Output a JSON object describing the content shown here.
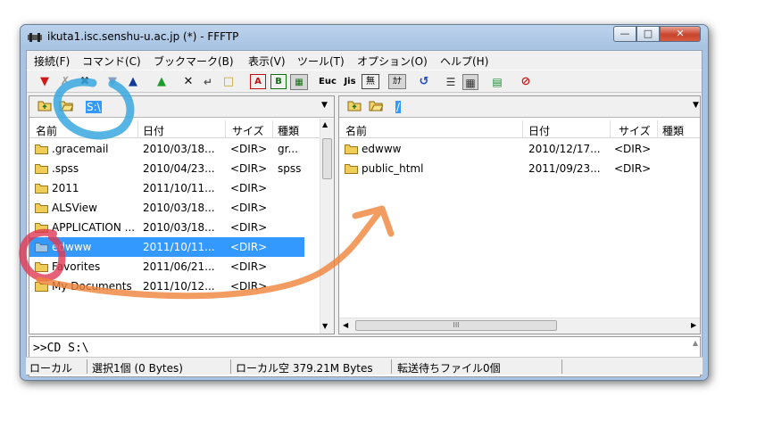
{
  "window": {
    "title": "ikuta1.isc.senshu-u.ac.jp (*) - FFFTP",
    "min_glyph": "—",
    "max_glyph": "□",
    "close_glyph": "✕"
  },
  "menu": [
    "接続(F)",
    "コマンド(C)",
    "ブックマーク(B)",
    "表示(V)",
    "ツール(T)",
    "オプション(O)",
    "ヘルプ(H)"
  ],
  "toolbar": {
    "ascii": "A",
    "binary": "B",
    "euc": "Euc",
    "jis": "Jis",
    "no_conv": "無",
    "kana": "ｶﾅ"
  },
  "local": {
    "path": "S:\\",
    "headers": {
      "name": "名前",
      "date": "日付",
      "size": "サイズ",
      "type": "種類"
    },
    "files": [
      {
        "name": ".gracemail",
        "date": "2010/03/18...",
        "size": "<DIR>",
        "type": "gr..."
      },
      {
        "name": ".spss",
        "date": "2010/04/23...",
        "size": "<DIR>",
        "type": "spss"
      },
      {
        "name": "2011",
        "date": "2011/10/11...",
        "size": "<DIR>",
        "type": ""
      },
      {
        "name": "ALSView",
        "date": "2010/03/18...",
        "size": "<DIR>",
        "type": ""
      },
      {
        "name": "APPLICATION ...",
        "date": "2010/03/18...",
        "size": "<DIR>",
        "type": ""
      },
      {
        "name": "edwww",
        "date": "2011/10/11...",
        "size": "<DIR>",
        "type": ""
      },
      {
        "name": "Favorites",
        "date": "2011/06/21...",
        "size": "<DIR>",
        "type": ""
      },
      {
        "name": "My Documents",
        "date": "2011/10/12...",
        "size": "<DIR>",
        "type": ""
      }
    ]
  },
  "remote": {
    "path": "/",
    "headers": {
      "name": "名前",
      "date": "日付",
      "size": "サイズ",
      "type": "種類"
    },
    "files": [
      {
        "name": "edwww",
        "date": "2010/12/17...",
        "size": "<DIR>",
        "type": ""
      },
      {
        "name": "public_html",
        "date": "2011/09/23...",
        "size": "<DIR>",
        "type": ""
      }
    ],
    "hscroll_grip": "III"
  },
  "log": {
    "text": ">>CD S:\\"
  },
  "status": {
    "mode": "ローカル",
    "selection": "選択1個 (0 Bytes)",
    "free": "ローカル空 379.21M Bytes",
    "queue": "転送待ちファイル0個"
  },
  "colors": {
    "selection": "#3399ff",
    "annotation_blue": "#3aa8e0",
    "annotation_red": "#e03a52",
    "annotation_orange": "#f0833a"
  }
}
